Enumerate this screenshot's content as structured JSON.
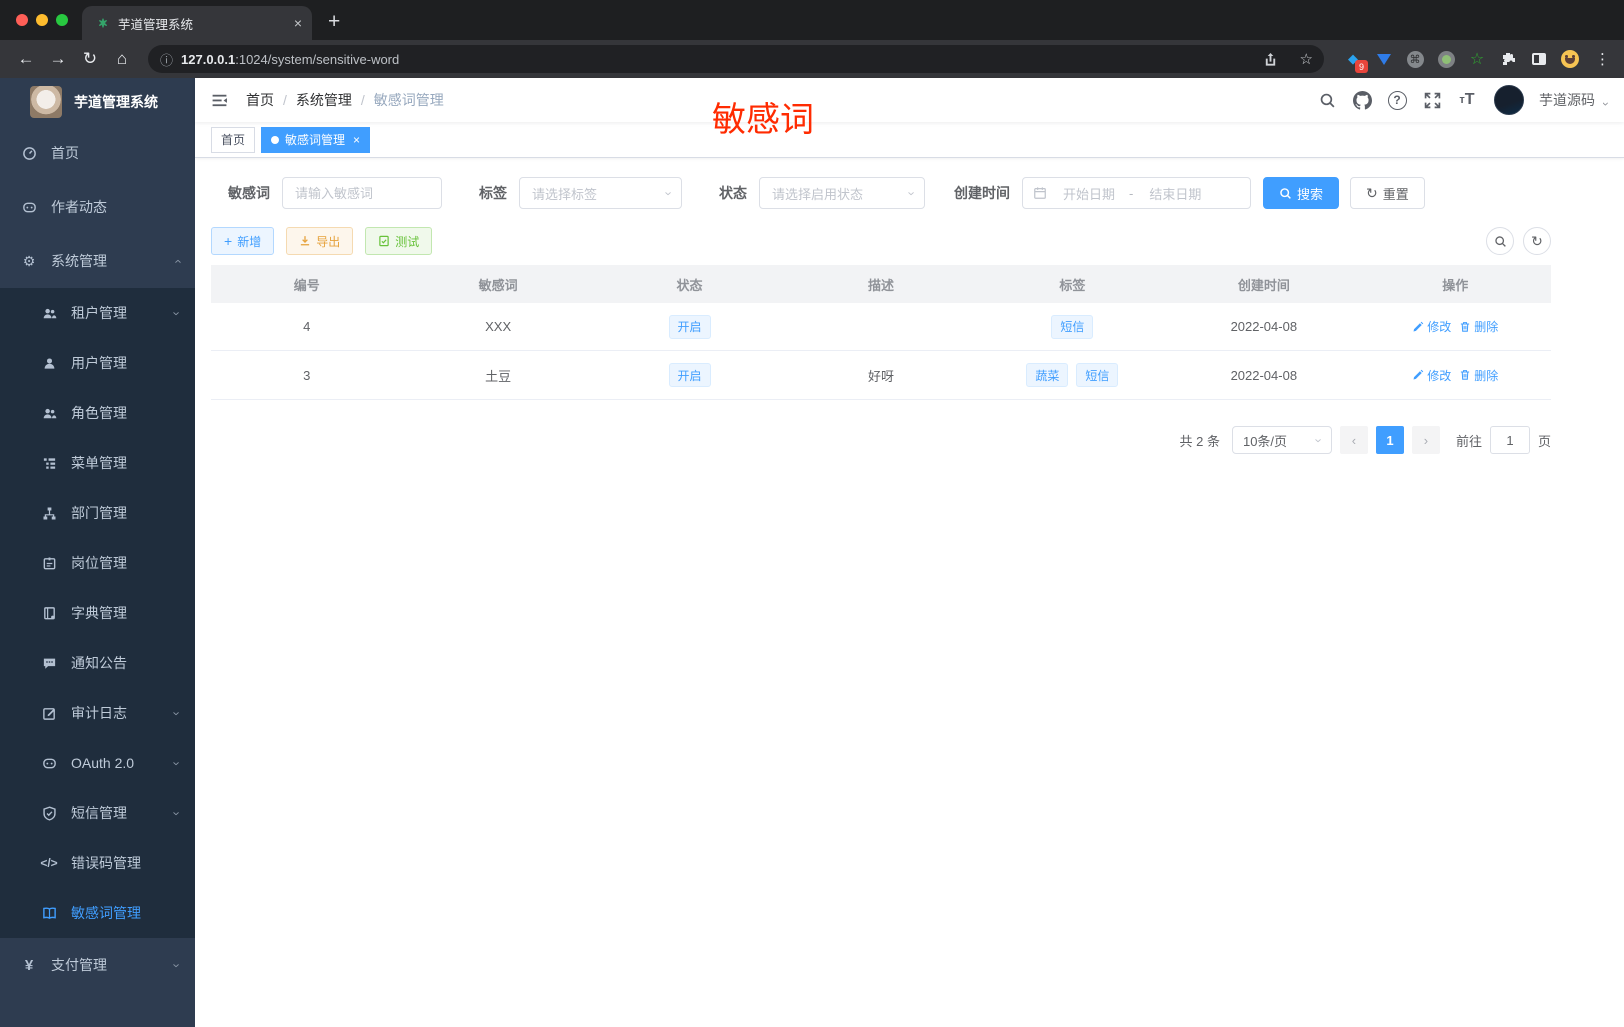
{
  "browser": {
    "tab_title": "芋道管理系统",
    "close_tab": "×",
    "new_tab": "+",
    "back": "←",
    "forward": "→",
    "reload": "↻",
    "home": "⌂",
    "url_info": "ⓘ",
    "url_host": "127.0.0.1",
    "url_rest": ":1024/system/sensitive-word",
    "star": "☆",
    "ext_badge": "9",
    "ext_cmd": "⌘",
    "menu_kebab": "⋮"
  },
  "sidebar": {
    "title": "芋道管理系统",
    "items": [
      {
        "label": "首页"
      },
      {
        "label": "作者动态"
      },
      {
        "label": "系统管理"
      },
      {
        "label": "租户管理"
      },
      {
        "label": "用户管理"
      },
      {
        "label": "角色管理"
      },
      {
        "label": "菜单管理"
      },
      {
        "label": "部门管理"
      },
      {
        "label": "岗位管理"
      },
      {
        "label": "字典管理"
      },
      {
        "label": "通知公告"
      },
      {
        "label": "审计日志"
      },
      {
        "label": "OAuth 2.0"
      },
      {
        "label": "短信管理"
      },
      {
        "label": "错误码管理"
      },
      {
        "label": "敏感词管理"
      },
      {
        "label": "支付管理"
      }
    ],
    "errcode_glyph": "</>",
    "pay_glyph": "¥"
  },
  "header": {
    "breadcrumb": [
      "首页",
      "系统管理",
      "敏感词管理"
    ],
    "annotation": "敏感词",
    "user_name": "芋道源码",
    "help_glyph": "?",
    "fontsize_glyph": "T"
  },
  "tags_view": {
    "tabs": [
      {
        "label": "首页"
      },
      {
        "label": "敏感词管理",
        "close": "×"
      }
    ]
  },
  "filters": {
    "word_label": "敏感词",
    "word_placeholder": "请输入敏感词",
    "tag_label": "标签",
    "tag_placeholder": "请选择标签",
    "status_label": "状态",
    "status_placeholder": "请选择启用状态",
    "time_label": "创建时间",
    "start_placeholder": "开始日期",
    "range_separator": "-",
    "end_placeholder": "结束日期",
    "search_label": "搜索",
    "reset_label": "重置"
  },
  "toolbar": {
    "add_label": "新增",
    "add_glyph": "+",
    "export_label": "导出",
    "test_label": "测试"
  },
  "table": {
    "columns": [
      "编号",
      "敏感词",
      "状态",
      "描述",
      "标签",
      "创建时间",
      "操作"
    ],
    "rows": [
      {
        "id": "4",
        "word": "XXX",
        "status": "开启",
        "desc": "",
        "tags": [
          "短信"
        ],
        "created": "2022-04-08",
        "edit": "修改",
        "delete": "删除"
      },
      {
        "id": "3",
        "word": "土豆",
        "status": "开启",
        "desc": "好呀",
        "tags": [
          "蔬菜",
          "短信"
        ],
        "created": "2022-04-08",
        "edit": "修改",
        "delete": "删除"
      }
    ]
  },
  "pagination": {
    "total_text": "共 2 条",
    "page_size": "10条/页",
    "prev": "‹",
    "current": "1",
    "next": "›",
    "goto_label": "前往",
    "goto_value": "1",
    "page_unit": "页"
  },
  "colors": {
    "primary": "#409eff",
    "annotation_red": "#ff2b01",
    "sidebar_bg": "#2e3c50",
    "submenu_bg": "#1f2d3d"
  }
}
